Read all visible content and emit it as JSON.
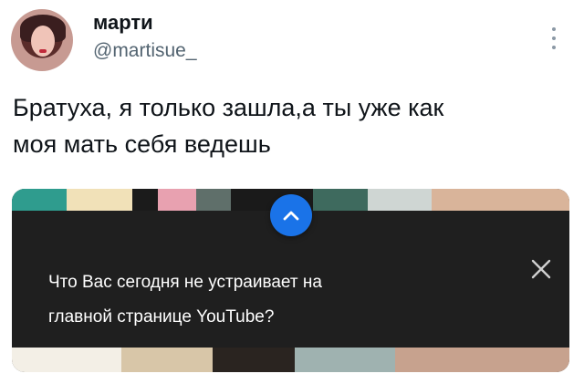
{
  "tweet": {
    "author_name": "марти",
    "author_handle": "@martisue_",
    "text_lines": [
      "Братуха, я только зашла,а ты уже как",
      "моя мать себя ведешь"
    ]
  },
  "media": {
    "popup": {
      "text_lines": [
        "Что Вас сегодня не устраивает на",
        "главной странице YouTube?"
      ],
      "collapse_icon": "chevron-up-icon",
      "close_icon": "close-icon"
    }
  },
  "colors": {
    "handle_gray": "#536471",
    "popup_bg": "#1f1f1f",
    "accent_blue": "#1a73e8"
  }
}
